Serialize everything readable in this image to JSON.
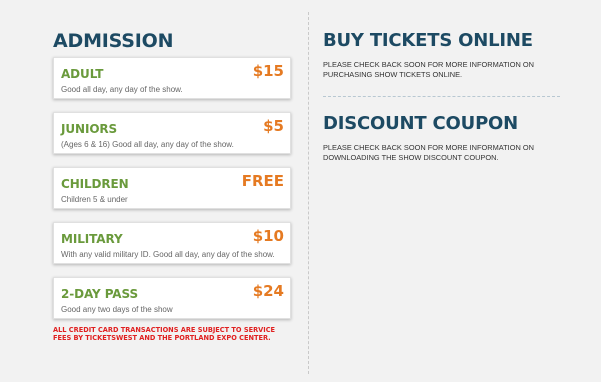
{
  "admission": {
    "title": "ADMISSION",
    "tickets": [
      {
        "name": "ADULT",
        "price": "$15",
        "description": "Good all day, any day of the show."
      },
      {
        "name": "JUNIORS",
        "price": "$5",
        "description": "(Ages 6 & 16) Good all day, any day of the show."
      },
      {
        "name": "CHILDREN",
        "price": "FREE",
        "description": "Children 5 & under"
      },
      {
        "name": "MILITARY",
        "price": "$10",
        "description": "With any valid military ID. Good all day, any day of the show."
      },
      {
        "name": "2-DAY PASS",
        "price": "$24",
        "description": "Good any two days of the show"
      }
    ],
    "disclaimer": "ALL CREDIT CARD TRANSACTIONS ARE SUBJECT TO SERVICE FEES BY TICKETSWEST AND THE PORTLAND EXPO CENTER."
  },
  "buy_tickets": {
    "title": "BUY TICKETS ONLINE",
    "text": "PLEASE CHECK BACK SOON FOR MORE INFORMATION ON PURCHASING SHOW TICKETS ONLINE."
  },
  "discount_coupon": {
    "title": "DISCOUNT COUPON",
    "text": "PLEASE CHECK BACK SOON FOR MORE INFORMATION ON DOWNLOADING THE SHOW DISCOUNT COUPON."
  },
  "colors": {
    "heading": "#1d4a63",
    "ticket_name": "#6a9a3c",
    "price": "#e57a22",
    "disclaimer": "#e02020",
    "background": "#f2f2f2"
  }
}
